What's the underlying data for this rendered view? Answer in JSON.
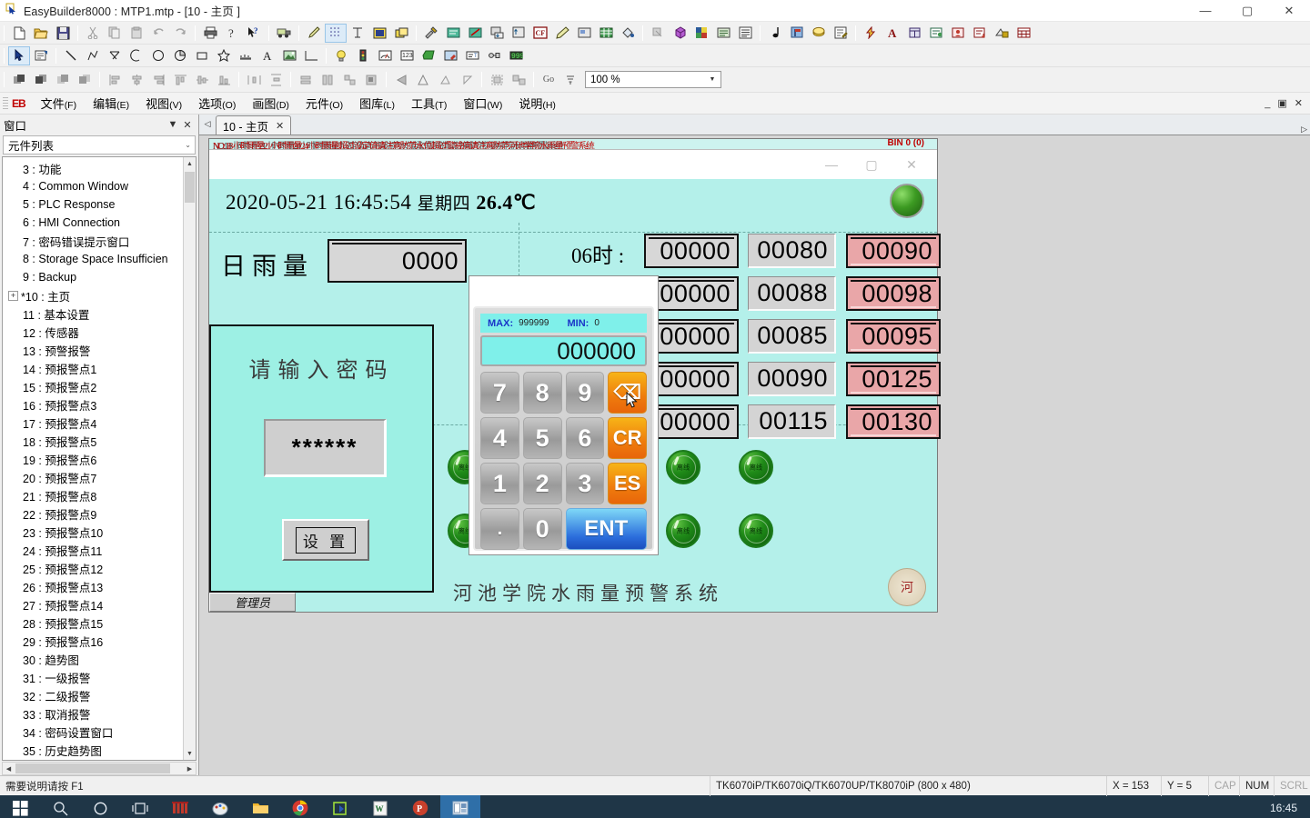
{
  "window": {
    "title": "EasyBuilder8000 : MTP1.mtp - [10 - 主页 ]",
    "minimize": "—",
    "maximize": "▢",
    "close": "✕"
  },
  "menubar": {
    "logo": "EB",
    "items": [
      {
        "label": "文件",
        "mnemonic": "(F)"
      },
      {
        "label": "编辑",
        "mnemonic": "(E)"
      },
      {
        "label": "视图",
        "mnemonic": "(V)"
      },
      {
        "label": "选项",
        "mnemonic": "(O)"
      },
      {
        "label": "画图",
        "mnemonic": "(D)"
      },
      {
        "label": "元件",
        "mnemonic": "(O)"
      },
      {
        "label": "图库",
        "mnemonic": "(L)"
      },
      {
        "label": "工具",
        "mnemonic": "(T)"
      },
      {
        "label": "窗口",
        "mnemonic": "(W)"
      },
      {
        "label": "说明",
        "mnemonic": "(H)"
      }
    ],
    "min_label": "_",
    "restore_label": "▣",
    "close_label": "✕"
  },
  "toolbar_zoom": {
    "value": "100 %",
    "go_label": "Go"
  },
  "sidebar": {
    "panel_title": "窗口",
    "panel_menu_icon": "▼",
    "panel_close_icon": "✕",
    "combo_value": "元件列表",
    "combo_arrow": "⌄",
    "tree": [
      {
        "label": "3 : 功能",
        "expandable": false
      },
      {
        "label": "4 : Common Window",
        "expandable": false
      },
      {
        "label": "5 : PLC Response",
        "expandable": false
      },
      {
        "label": "6 : HMI Connection",
        "expandable": false
      },
      {
        "label": "7 : 密码错误提示窗口",
        "expandable": false
      },
      {
        "label": "8 : Storage Space Insufficien",
        "expandable": false
      },
      {
        "label": "9 : Backup",
        "expandable": false
      },
      {
        "label": "*10 : 主页",
        "expandable": true
      },
      {
        "label": "11 : 基本设置",
        "expandable": false
      },
      {
        "label": "12 : 传感器",
        "expandable": false
      },
      {
        "label": "13 : 预警报警",
        "expandable": false
      },
      {
        "label": "14 : 预报警点1",
        "expandable": false
      },
      {
        "label": "15 : 预报警点2",
        "expandable": false
      },
      {
        "label": "16 : 预报警点3",
        "expandable": false
      },
      {
        "label": "17 : 预报警点4",
        "expandable": false
      },
      {
        "label": "18 : 预报警点5",
        "expandable": false
      },
      {
        "label": "19 : 预报警点6",
        "expandable": false
      },
      {
        "label": "20 : 预报警点7",
        "expandable": false
      },
      {
        "label": "21 : 预报警点8",
        "expandable": false
      },
      {
        "label": "22 : 预报警点9",
        "expandable": false
      },
      {
        "label": "23 : 预报警点10",
        "expandable": false
      },
      {
        "label": "24 : 预报警点11",
        "expandable": false
      },
      {
        "label": "25 : 预报警点12",
        "expandable": false
      },
      {
        "label": "26 : 预报警点13",
        "expandable": false
      },
      {
        "label": "27 : 预报警点14",
        "expandable": false
      },
      {
        "label": "28 : 预报警点15",
        "expandable": false
      },
      {
        "label": "29 : 预报警点16",
        "expandable": false
      },
      {
        "label": "30 : 趋势图",
        "expandable": false
      },
      {
        "label": "31 : 一级报警",
        "expandable": false
      },
      {
        "label": "32 : 二级报警",
        "expandable": false
      },
      {
        "label": "33 : 取消报警",
        "expandable": false
      },
      {
        "label": "34 : 密码设置窗口",
        "expandable": false
      },
      {
        "label": "35 : 历史趋势图",
        "expandable": false
      }
    ]
  },
  "tabs": {
    "left_nav": "◁",
    "right_nav": "▷",
    "items": [
      {
        "label": "10 - 主页",
        "close": "✕",
        "active": true
      }
    ]
  },
  "hmi": {
    "alarm_ticker": "NO: 18 小时雨量21小时雨量24小时雨量超过设定值请注意防范水位超过警戒值请注意防范河池学院水雨量预警系统",
    "bin_label": "BIN 0 (0)",
    "win_minimize": "—",
    "win_maximize": "▢",
    "win_close": "✕",
    "date": "2020-05-21",
    "time": "16:45:54",
    "weekday": "星期四",
    "temperature": "26.4℃",
    "rain_label": "日雨量",
    "rain_value": "0000",
    "hour_label": "06时 :",
    "rows": [
      {
        "current": "00000",
        "warn": "00080",
        "alarm": "00090"
      },
      {
        "current": "00000",
        "warn": "00088",
        "alarm": "00098"
      },
      {
        "current": "00000",
        "warn": "00085",
        "alarm": "00095"
      },
      {
        "current": "00000",
        "warn": "00090",
        "alarm": "00125"
      },
      {
        "current": "00000",
        "warn": "00115",
        "alarm": "00130"
      }
    ],
    "lamp_label": "离线",
    "footer_title": "河池学院水雨量预警系统",
    "admin_button": "管理员",
    "badge_text": "河"
  },
  "password_dialog": {
    "title": "请输入密码",
    "value": "******",
    "set_button": "设 置"
  },
  "keypad": {
    "max_label": "MAX:",
    "max_value": "999999",
    "min_label": "MIN:",
    "min_value": "0",
    "display": "000000",
    "keys": [
      {
        "label": "7",
        "type": "num"
      },
      {
        "label": "8",
        "type": "num"
      },
      {
        "label": "9",
        "type": "num"
      },
      {
        "label": "⌫",
        "type": "orange"
      },
      {
        "label": "4",
        "type": "num"
      },
      {
        "label": "5",
        "type": "num"
      },
      {
        "label": "6",
        "type": "num"
      },
      {
        "label": "CR",
        "type": "orange"
      },
      {
        "label": "1",
        "type": "num"
      },
      {
        "label": "2",
        "type": "num"
      },
      {
        "label": "3",
        "type": "num"
      },
      {
        "label": "ES",
        "type": "orange"
      },
      {
        "label": ".",
        "type": "dot"
      },
      {
        "label": "0",
        "type": "num"
      },
      {
        "label": "ENT",
        "type": "blue"
      }
    ]
  },
  "statusbar": {
    "hint": "需要说明请按 F1",
    "model": "TK6070iP/TK6070iQ/TK6070UP/TK8070iP (800 x 480)",
    "x": "X = 153",
    "y": "Y = 5",
    "cap": "CAP",
    "num": "NUM",
    "scrl": "SCRL"
  },
  "taskbar": {
    "clock": "16:45",
    "items": [
      {
        "name": "start-button"
      },
      {
        "name": "search-button"
      },
      {
        "name": "cortana-button"
      },
      {
        "name": "task-view-button"
      },
      {
        "name": "app-red"
      },
      {
        "name": "app-paint"
      },
      {
        "name": "file-explorer"
      },
      {
        "name": "chrome"
      },
      {
        "name": "app-green"
      },
      {
        "name": "wps-writer"
      },
      {
        "name": "powerpoint"
      },
      {
        "name": "easybuilder"
      }
    ]
  },
  "colors": {
    "hmi_bg": "#b4f0ea",
    "dialog_bg": "#9df0e4",
    "alarm_red": "#c00000",
    "pink_field": "#e9a6a8",
    "accent_blue": "#2b6ddc",
    "orange_key": "#ef7b0d"
  }
}
